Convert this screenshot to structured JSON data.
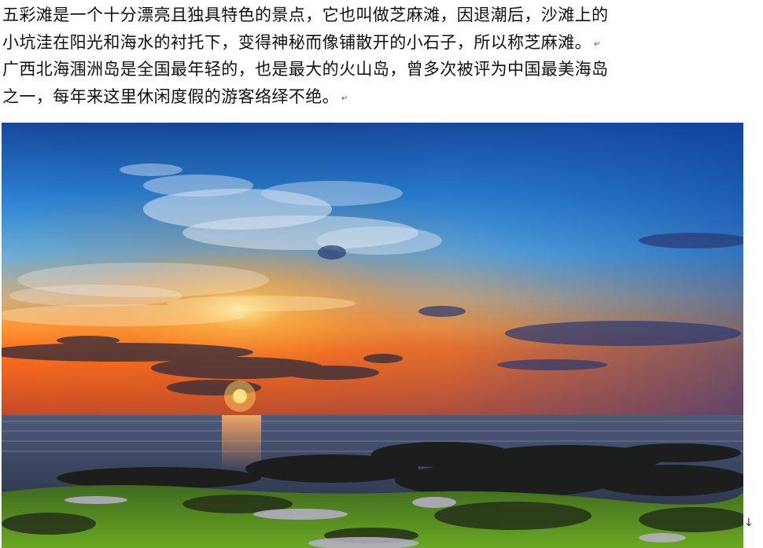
{
  "document": {
    "lines": [
      "五彩滩是一个十分漂亮且独具特色的景点，它也叫做芝麻滩，因退潮后，沙滩上的",
      "小坑洼在阳光和海水的衬托下，变得神秘而像铺散开的小石子，所以称芝麻滩。",
      "广西北海涠洲岛是全国最年轻的，也是最大的火山岛，曾多次被评为中国最美海岛",
      "之一，每年来这里休闲度假的游客络绎不绝。"
    ],
    "paragraph_mark": "↵",
    "end_mark": "↓"
  },
  "photo": {
    "subject": "sunset-over-sea-with-mossy-rocks",
    "colors": {
      "sky_top": "#1f5fb8",
      "sky_mid": "#3f9fe0",
      "horizon_glow": "#ff8a1e",
      "sun": "#ffe36a",
      "sea": "#2b3648",
      "moss": "#5e9a1c"
    }
  }
}
